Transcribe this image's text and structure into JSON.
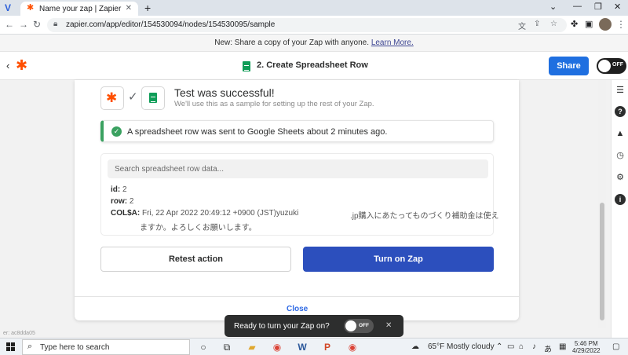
{
  "browser": {
    "tab_title": "Name your zap | Zapier",
    "url": "zapier.com/app/editor/154530094/nodes/154530095/sample"
  },
  "banner": {
    "text": "New: Share a copy of your Zap with anyone.",
    "link": "Learn More."
  },
  "header": {
    "step_title": "2. Create Spreadsheet Row",
    "share_label": "Share",
    "toggle_label": "OFF"
  },
  "test": {
    "title": "Test was successful!",
    "subtitle": "We'll use this as a sample for setting up the rest of your Zap."
  },
  "alert": {
    "message": "A spreadsheet row was sent to Google Sheets about 2 minutes ago."
  },
  "data": {
    "search_placeholder": "Search spreadsheet row data...",
    "fields": [
      {
        "key": "id:",
        "value": "2"
      },
      {
        "key": "row:",
        "value": "2"
      },
      {
        "key": "COL$A:",
        "value": "Fri, 22 Apr 2022 20:49:12 +0900 (JST)yuzuki"
      }
    ],
    "jp_line1": ".jp購入にあたってものづくり補助金は使え",
    "jp_line2": "ますか。よろしくお願いします。"
  },
  "actions": {
    "retest_label": "Retest action",
    "turn_on_label": "Turn on Zap",
    "close_label": "Close"
  },
  "status_text": "er: ac8dda05",
  "snackbar": {
    "text": "Ready to turn your Zap on?",
    "toggle_label": "OFF"
  },
  "taskbar": {
    "search_placeholder": "Type here to search",
    "weather": "65°F  Mostly cloudy",
    "time": "5:46 PM",
    "date": "4/29/2022"
  },
  "colors": {
    "brand_orange": "#ff4f00",
    "primary_blue": "#2c4fbd",
    "success_green": "#3aa160"
  }
}
